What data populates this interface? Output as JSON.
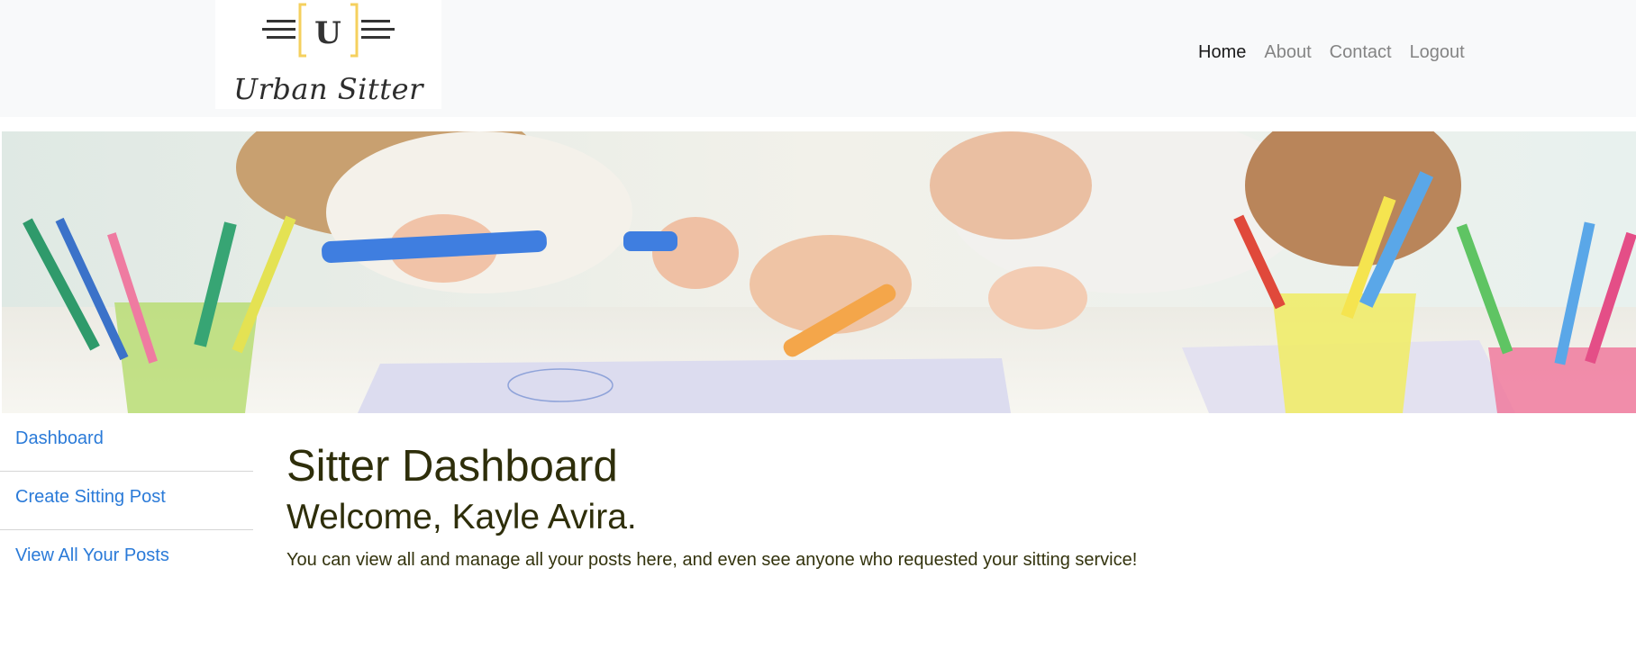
{
  "brand": {
    "logo_letter": "U",
    "name": "Urban Sitter",
    "accent_color": "#f5d05e"
  },
  "nav": {
    "items": [
      {
        "label": "Home",
        "active": true
      },
      {
        "label": "About",
        "active": false
      },
      {
        "label": "Contact",
        "active": false
      },
      {
        "label": "Logout",
        "active": false
      }
    ]
  },
  "hero": {
    "image_description": "children drawing with colored markers at a table"
  },
  "sidebar": {
    "items": [
      {
        "label": "Dashboard"
      },
      {
        "label": "Create Sitting Post"
      },
      {
        "label": "View All Your Posts"
      }
    ],
    "link_color": "#2a7ad8"
  },
  "main": {
    "title": "Sitter Dashboard",
    "welcome": "Welcome, Kayle Avira.",
    "intro": "You can view all and manage all your posts here, and even see anyone who requested your sitting service!"
  }
}
